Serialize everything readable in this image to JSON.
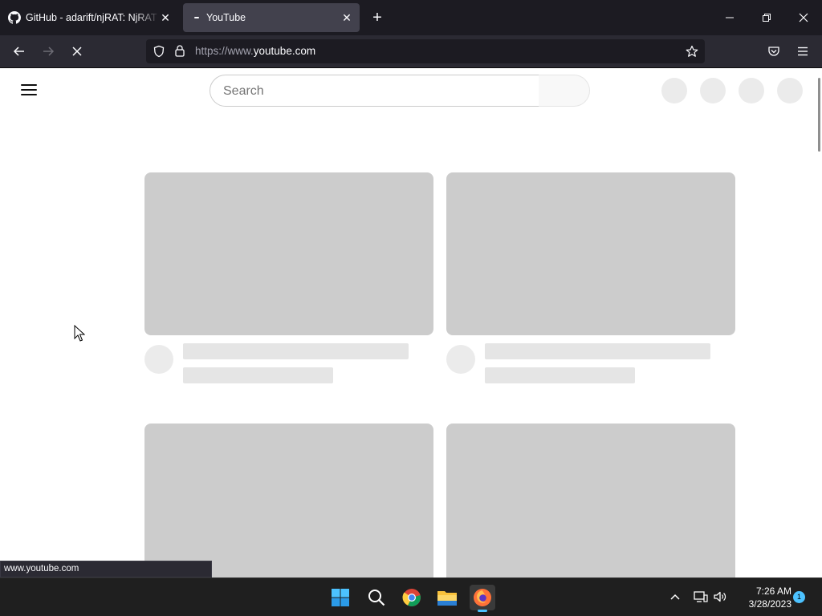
{
  "browser": {
    "tabs": [
      {
        "title": "GitHub - adarift/njRAT: NjRAT is",
        "close": "✕",
        "icon": "github-icon"
      },
      {
        "title": "YouTube",
        "close": "✕",
        "icon": "loading-icon"
      }
    ],
    "new_tab_symbol": "+",
    "url_prefix": "https://www.",
    "url_host": "youtube.com",
    "status_link": "www.youtube.com"
  },
  "page": {
    "search_placeholder": "Search"
  },
  "taskbar": {
    "time": "7:26 AM",
    "date": "3/28/2023",
    "notifications": "1",
    "apps": [
      "start-icon",
      "search-icon",
      "chrome-icon",
      "file-explorer-icon",
      "firefox-icon"
    ]
  },
  "colors": {
    "tab_active": "#42414d",
    "nav_bg": "#2b2a33",
    "skeleton_thumb": "#cccccc",
    "skeleton_text": "#e5e5e5",
    "accent": "#4cc2ff"
  }
}
